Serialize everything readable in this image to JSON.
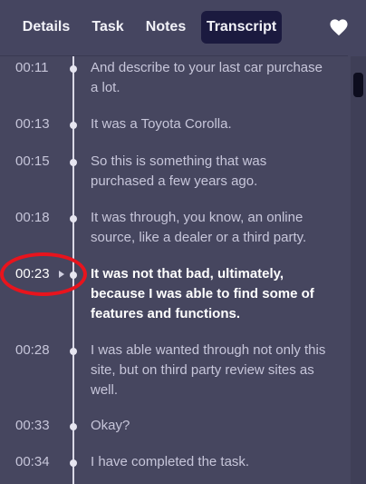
{
  "tabs": {
    "details": "Details",
    "task": "Task",
    "notes": "Notes",
    "transcript": "Transcript",
    "active": "Transcript"
  },
  "icons": {
    "favorite": "heart-icon",
    "play": "play-icon"
  },
  "colors": {
    "background": "#46465f",
    "active_tab": "#1b1a3f",
    "highlight_ring": "#e8141d"
  },
  "transcript": [
    {
      "time": "00:11",
      "text": "And describe to your last car purchase a lot.",
      "active": false
    },
    {
      "time": "00:13",
      "text": "It was a Toyota Corolla.",
      "active": false
    },
    {
      "time": "00:15",
      "text": "So this is something that was purchased a few years ago.",
      "active": false
    },
    {
      "time": "00:18",
      "text": "It was through, you know, an online source, like a dealer or a third party.",
      "active": false
    },
    {
      "time": "00:23",
      "text": "It was not that bad, ultimately, because I was able to find some of features and functions.",
      "active": true
    },
    {
      "time": "00:28",
      "text": "I was able wanted through not only this site, but on third party review sites as well.",
      "active": false
    },
    {
      "time": "00:33",
      "text": "Okay?",
      "active": false
    },
    {
      "time": "00:34",
      "text": "I have completed the task.",
      "active": false
    }
  ]
}
